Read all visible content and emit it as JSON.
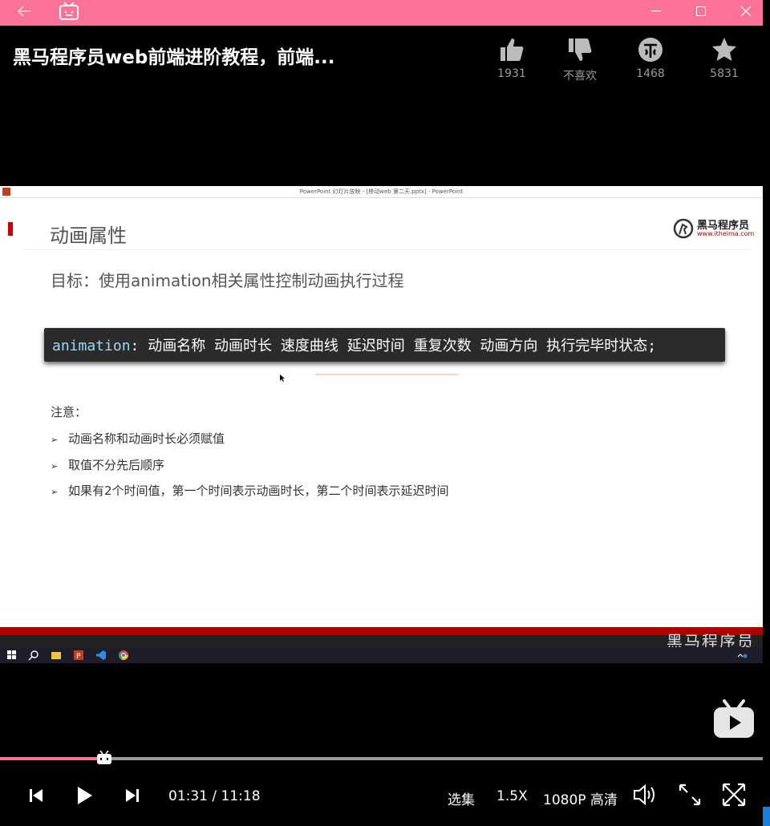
{
  "video": {
    "title": "黑马程序员web前端进阶教程，前端...",
    "actions": [
      {
        "name": "like",
        "icon": "thumbs-up-icon",
        "count": "1931"
      },
      {
        "name": "dislike",
        "icon": "thumbs-down-icon",
        "count": "不喜欢"
      },
      {
        "name": "coin",
        "icon": "coin-icon",
        "count": "1468"
      },
      {
        "name": "favorite",
        "icon": "star-icon",
        "count": "5831"
      }
    ]
  },
  "ppt": {
    "window_title": "PowerPoint 幻灯片放映 - [移动web 第二天.pptx] - PowerPoint",
    "slide_title": "动画属性",
    "logo_text": "黑马程序员",
    "logo_url": "www.itheima.com",
    "target": "目标：使用animation相关属性控制动画执行过程",
    "code_keyword": "animation",
    "code_rest": ": 动画名称 动画时长 速度曲线 延迟时间 重复次数 动画方向 执行完毕时状态;",
    "note_title": "注意：",
    "bullets": [
      "动画名称和动画时长必须赋值",
      "取值不分先后顺序",
      "如果有2个时间值，第一个时间表示动画时长，第二个时间表示延迟时间"
    ],
    "footer_brand": "黑马程序员"
  },
  "player": {
    "progress": 0.137,
    "time": "01:31 / 11:18",
    "episodes_label": "选集",
    "speed_label": "1.5X",
    "quality_label": "1080P 高清"
  },
  "colors": {
    "accent": "#fb7299",
    "code_bg": "#2b2b2b",
    "slide_footer": "#b00000"
  }
}
